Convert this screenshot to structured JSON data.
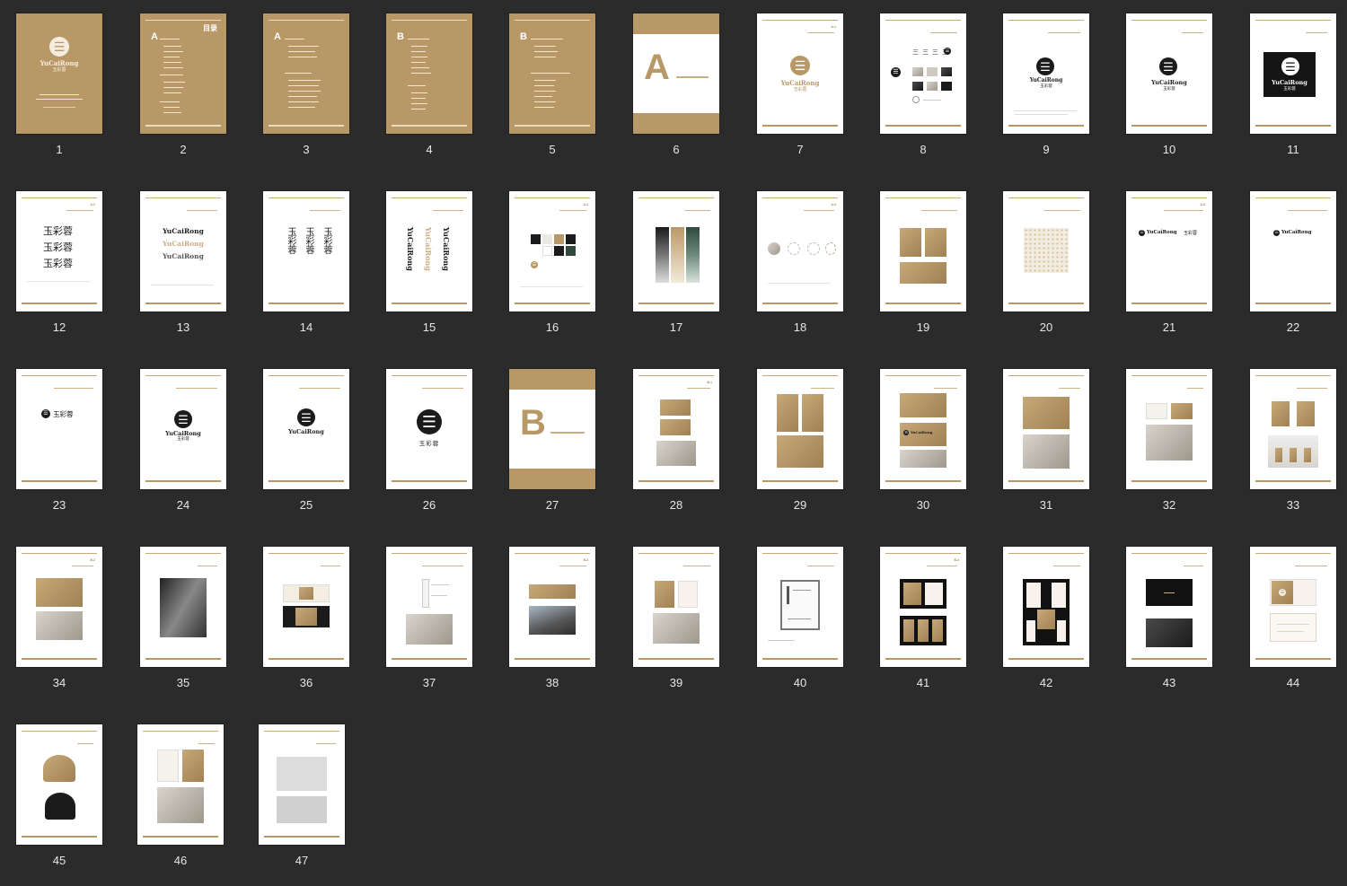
{
  "colors": {
    "background": "#2b2b2c",
    "kraft": "#b99868",
    "ink": "#1b1b1b",
    "page": "#ffffff",
    "label": "#e6e6e6"
  },
  "pages": [
    {
      "num": "1",
      "wordmark": "YuCaiRong",
      "cn": "玉彩蓉"
    },
    {
      "num": "2",
      "letter": "A",
      "title": "目录"
    },
    {
      "num": "3",
      "letter": "A"
    },
    {
      "num": "4",
      "letter": "B"
    },
    {
      "num": "5",
      "letter": "B"
    },
    {
      "num": "6",
      "letter": "A"
    },
    {
      "num": "7",
      "wordmark": "YuCaiRong",
      "cn": "玉彩蓉"
    },
    {
      "num": "8"
    },
    {
      "num": "9",
      "wordmark": "YuCaiRong",
      "cn": "玉彩蓉"
    },
    {
      "num": "10",
      "wordmark": "YuCaiRong",
      "cn": "玉彩蓉"
    },
    {
      "num": "11",
      "wordmark": "YuCaiRong",
      "cn": "玉彩蓉"
    },
    {
      "num": "12",
      "cn": "玉彩蓉"
    },
    {
      "num": "13",
      "wordmark": "YuCaiRong"
    },
    {
      "num": "14",
      "cn": "玉彩蓉"
    },
    {
      "num": "15",
      "wordmark": "YuCaiRong"
    },
    {
      "num": "16"
    },
    {
      "num": "17"
    },
    {
      "num": "18"
    },
    {
      "num": "19"
    },
    {
      "num": "20"
    },
    {
      "num": "21",
      "wordmark": "YuCaiRong",
      "cn": "玉彩蓉"
    },
    {
      "num": "22",
      "wordmark": "YuCaiRong"
    },
    {
      "num": "23",
      "cn": "玉彩蓉"
    },
    {
      "num": "24",
      "wordmark": "YuCaiRong",
      "cn": "玉彩蓉"
    },
    {
      "num": "25",
      "wordmark": "YuCaiRong"
    },
    {
      "num": "26",
      "cn": "玉彩蓉"
    },
    {
      "num": "27",
      "letter": "B"
    },
    {
      "num": "28"
    },
    {
      "num": "29"
    },
    {
      "num": "30"
    },
    {
      "num": "31"
    },
    {
      "num": "32"
    },
    {
      "num": "33"
    },
    {
      "num": "34"
    },
    {
      "num": "35"
    },
    {
      "num": "36"
    },
    {
      "num": "37"
    },
    {
      "num": "38"
    },
    {
      "num": "39"
    },
    {
      "num": "40"
    },
    {
      "num": "41"
    },
    {
      "num": "42"
    },
    {
      "num": "43"
    },
    {
      "num": "44"
    },
    {
      "num": "45"
    },
    {
      "num": "46"
    },
    {
      "num": "47"
    }
  ]
}
